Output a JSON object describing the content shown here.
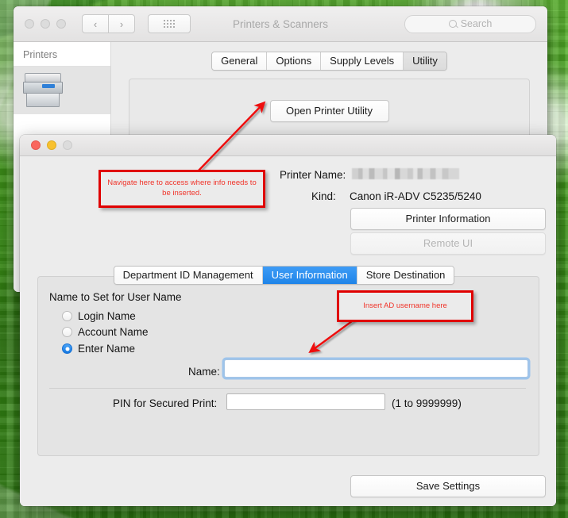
{
  "desktop": {
    "wallpaper": "green-pixelated",
    "accent": "#4caf25"
  },
  "prefs_window": {
    "title": "Printers & Scanners",
    "traffic_lights": [
      "close",
      "minimize",
      "zoom"
    ],
    "nav": {
      "back": "‹",
      "forward": "›"
    },
    "grid_button": "show-all-icon",
    "search": {
      "placeholder": "Search",
      "value": ""
    },
    "sidebar": {
      "header": "Printers",
      "items": [
        {
          "label": "",
          "icon": "printer-icon"
        }
      ]
    },
    "tabs": [
      {
        "label": "General",
        "active": false
      },
      {
        "label": "Options",
        "active": false
      },
      {
        "label": "Supply Levels",
        "active": false
      },
      {
        "label": "Utility",
        "active": true
      }
    ],
    "open_printer_utility": "Open Printer Utility"
  },
  "utility_window": {
    "traffic_lights": [
      "close",
      "minimize",
      "zoom-disabled"
    ],
    "info": {
      "printer_name_label": "Printer Name:",
      "printer_name_value": "",
      "kind_label": "Kind:",
      "kind_value": "Canon iR-ADV C5235/5240"
    },
    "buttons": {
      "printer_information": "Printer Information",
      "remote_ui": "Remote UI",
      "save_settings": "Save Settings"
    },
    "tabs": [
      {
        "label": "Department ID Management",
        "active": false
      },
      {
        "label": "User Information",
        "active": true
      },
      {
        "label": "Store Destination",
        "active": false
      }
    ],
    "user_information": {
      "group_label": "Name to Set for User Name",
      "radios": [
        {
          "label": "Login Name",
          "selected": false
        },
        {
          "label": "Account Name",
          "selected": false
        },
        {
          "label": "Enter Name",
          "selected": true
        }
      ],
      "name_label": "Name:",
      "name_value": "",
      "pin_label": "PIN for Secured Print:",
      "pin_value": "",
      "pin_range": "(1 to 9999999)"
    }
  },
  "annotations": {
    "navigate": "Navigate here to access where info needs to be inserted.",
    "insert": "Insert AD username here",
    "color": "#e00000"
  }
}
